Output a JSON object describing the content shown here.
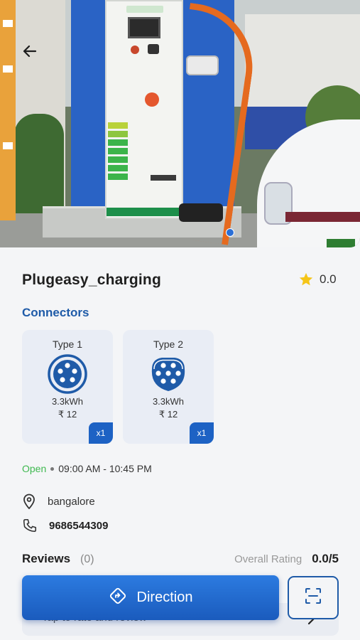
{
  "station": {
    "name": "Plugeasy_charging",
    "rating": "0.0"
  },
  "connectors_title": "Connectors",
  "connectors": [
    {
      "type": "Type 1",
      "power": "3.3kWh",
      "price": "₹ 12",
      "count": "x1"
    },
    {
      "type": "Type 2",
      "power": "3.3kWh",
      "price": "₹ 12",
      "count": "x1"
    }
  ],
  "hours": {
    "status": "Open",
    "range": "09:00 AM - 10:45 PM"
  },
  "location": "bangalore",
  "phone": "9686544309",
  "reviews": {
    "label": "Reviews",
    "count": "(0)",
    "overall_label": "Overall Rating",
    "overall_value": "0.0/5",
    "prompt": "Tap to rate and review"
  },
  "actions": {
    "direction_label": "Direction"
  },
  "colors": {
    "accent": "#1f5ba8",
    "button": "#2272d4",
    "open": "#3fb950",
    "star": "#f5c518"
  },
  "icons": [
    "back-arrow-icon",
    "star-icon",
    "type1-connector-icon",
    "type2-connector-icon",
    "location-pin-icon",
    "phone-icon",
    "direction-icon",
    "scan-icon",
    "chevron-right-icon"
  ]
}
